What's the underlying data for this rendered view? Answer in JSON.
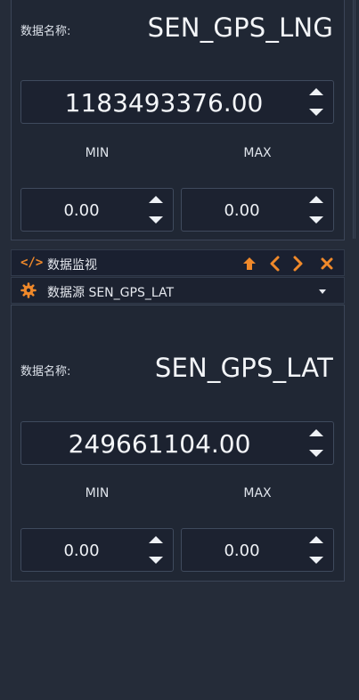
{
  "panel1": {
    "name_label": "数据名称:",
    "name_value": "SEN_GPS_LNG",
    "value": "1183493376.00",
    "min_label": "MIN",
    "max_label": "MAX",
    "min_value": "0.00",
    "max_value": "0.00"
  },
  "monitor": {
    "header": {
      "code_icon": "</>",
      "title": "数据监视",
      "controls": {
        "up_icon": "arrow-up-icon",
        "prev_icon": "chevron-left-icon",
        "next_icon": "chevron-right-icon",
        "close_icon": "close-icon"
      }
    },
    "source": {
      "icon": "gear-icon",
      "label": "数据源 SEN_GPS_LAT"
    }
  },
  "panel2": {
    "name_label": "数据名称:",
    "name_value": "SEN_GPS_LAT",
    "value": "249661104.00",
    "min_label": "MIN",
    "max_label": "MAX",
    "min_value": "0.00",
    "max_value": "0.00"
  },
  "colors": {
    "accent": "#f0892a",
    "background": "#252c39",
    "panel": "#202734",
    "border": "#3b4557"
  }
}
